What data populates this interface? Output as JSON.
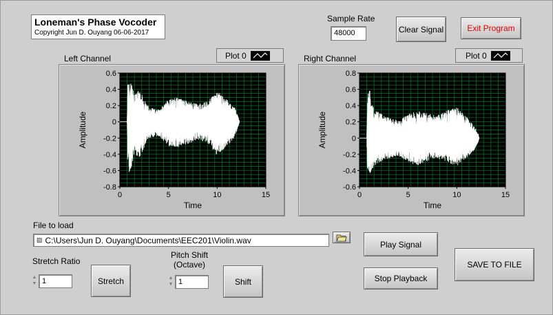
{
  "app": {
    "title": "Loneman's Phase Vocoder",
    "copyright": "Copyright Jun D. Ouyang 06-06-2017"
  },
  "sample_rate": {
    "label": "Sample Rate",
    "value": "48000"
  },
  "buttons": {
    "clear_signal": "Clear Signal",
    "exit_program": "Exit Program",
    "play_signal": "Play Signal",
    "stop_playback": "Stop Playback",
    "save_to_file": "SAVE TO FILE",
    "stretch": "Stretch",
    "shift": "Shift"
  },
  "file": {
    "label": "File to load",
    "path_icon": "path-icon",
    "value": "C:\\Users\\Jun D. Ouyang\\Documents\\EEC201\\Violin.wav",
    "browse_icon": "folder-icon"
  },
  "stretch_ratio": {
    "label": "Stretch Ratio",
    "value": "1"
  },
  "pitch_shift": {
    "label": "Pitch Shift",
    "label2": "(Octave)",
    "value": "1"
  },
  "colors": {
    "plot_bg": "#000000",
    "grid": "#007a2a",
    "trace": "#ffffff",
    "exit_text": "#e00000",
    "panel": "#cfcfcf"
  },
  "chart_data": [
    {
      "type": "line",
      "title": "Left Channel",
      "legend": "Plot 0",
      "xlabel": "Time",
      "ylabel": "Amplitude",
      "xlim": [
        0,
        15
      ],
      "ylim": [
        -0.8,
        0.6
      ],
      "xticks": [
        0,
        5,
        10,
        15
      ],
      "xtick_labels": [
        "0",
        "5",
        "10",
        "15"
      ],
      "yticks": [
        -0.8,
        -0.6,
        -0.4,
        -0.2,
        0,
        0.2,
        0.4,
        0.6
      ],
      "ytick_labels": [
        "-0.8",
        "-0.6",
        "-0.4",
        "-0.2",
        "0",
        "0.2",
        "0.4",
        "0.6"
      ],
      "grid": true,
      "series": [
        {
          "envelope": {
            "t": [
              0,
              0.75,
              0.8,
              1.0,
              1.5,
              2.0,
              3.0,
              4.0,
              5.0,
              6.0,
              7.0,
              8.0,
              9.0,
              10.0,
              11.0,
              11.8,
              12.2,
              12.3
            ],
            "upper": [
              0,
              0,
              0.5,
              0.55,
              0.35,
              0.4,
              0.18,
              0.15,
              0.28,
              0.3,
              0.25,
              0.22,
              0.25,
              0.38,
              0.28,
              0.18,
              0.05,
              0
            ],
            "lower": [
              0,
              0,
              -0.6,
              -0.65,
              -0.4,
              -0.45,
              -0.2,
              -0.18,
              -0.3,
              -0.32,
              -0.28,
              -0.22,
              -0.26,
              -0.42,
              -0.3,
              -0.2,
              -0.05,
              0
            ]
          }
        }
      ]
    },
    {
      "type": "line",
      "title": "Right Channel",
      "legend": "Plot 0",
      "xlabel": "Time",
      "ylabel": "Amplitude",
      "xlim": [
        0,
        15
      ],
      "ylim": [
        -0.6,
        0.8
      ],
      "xticks": [
        0,
        5,
        10,
        15
      ],
      "xtick_labels": [
        "0",
        "5",
        "10",
        "15"
      ],
      "yticks": [
        -0.6,
        -0.4,
        -0.2,
        0,
        0.2,
        0.4,
        0.6,
        0.8
      ],
      "ytick_labels": [
        "-0.6",
        "-0.4",
        "-0.2",
        "0",
        "0.2",
        "0.4",
        "0.6",
        "0.8"
      ],
      "grid": true,
      "series": [
        {
          "envelope": {
            "t": [
              0,
              0.75,
              0.8,
              1.0,
              1.5,
              2.0,
              3.0,
              4.0,
              5.0,
              6.0,
              7.0,
              8.0,
              9.0,
              10.0,
              11.0,
              11.8,
              12.2,
              12.3
            ],
            "upper": [
              0,
              0,
              0.55,
              0.62,
              0.35,
              0.32,
              0.25,
              0.22,
              0.3,
              0.34,
              0.3,
              0.28,
              0.34,
              0.38,
              0.26,
              0.15,
              0.05,
              0
            ],
            "lower": [
              0,
              0,
              -0.4,
              -0.45,
              -0.35,
              -0.3,
              -0.25,
              -0.22,
              -0.3,
              -0.34,
              -0.28,
              -0.25,
              -0.3,
              -0.35,
              -0.25,
              -0.15,
              -0.05,
              0
            ]
          }
        }
      ]
    }
  ]
}
